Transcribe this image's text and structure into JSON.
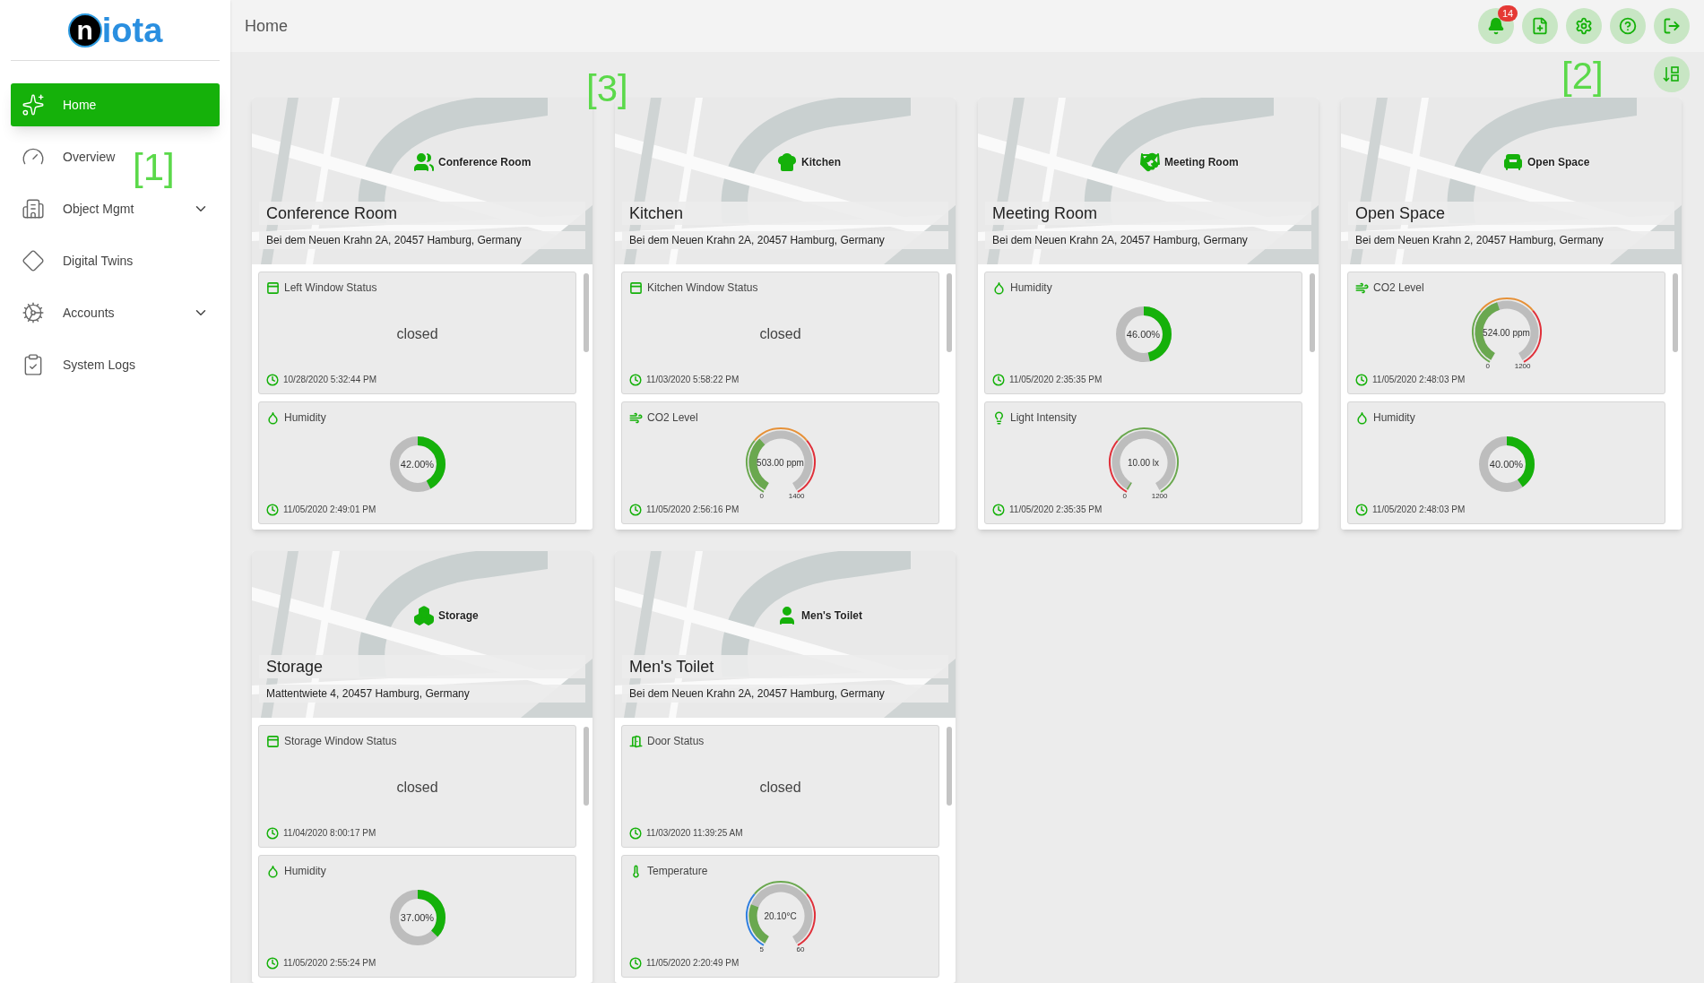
{
  "logo": {
    "mark": "n",
    "text": "iota"
  },
  "sidebar": {
    "items": [
      {
        "label": "Home",
        "kind": "home",
        "selected": true,
        "expandable": false
      },
      {
        "label": "Overview",
        "kind": "overview",
        "selected": false,
        "expandable": false
      },
      {
        "label": "Object Mgmt",
        "kind": "objects",
        "selected": false,
        "expandable": true
      },
      {
        "label": "Digital Twins",
        "kind": "twins",
        "selected": false,
        "expandable": false
      },
      {
        "label": "Accounts",
        "kind": "accounts",
        "selected": false,
        "expandable": true
      },
      {
        "label": "System Logs",
        "kind": "logs",
        "selected": false,
        "expandable": false
      }
    ]
  },
  "header": {
    "title": "Home",
    "notification_count": "14"
  },
  "annotations": [
    "[1]",
    "[2]",
    "[3]"
  ],
  "rooms": [
    {
      "name": "Conference Room",
      "kind": "conference",
      "marker_label": "Conference Room",
      "address": "Bei dem Neuen Krahn 2A, 20457 Hamburg, Germany",
      "widgets": [
        {
          "kind": "window",
          "title": "Left Window Status",
          "value": "closed",
          "timestamp": "10/28/2020 5:32:44 PM"
        },
        {
          "kind": "humidity",
          "title": "Humidity",
          "value": "42.00%",
          "level": 0.42,
          "timestamp": "11/05/2020 2:49:01 PM"
        }
      ]
    },
    {
      "name": "Kitchen",
      "kind": "kitchen",
      "marker_label": "Kitchen",
      "address": "Bei dem Neuen Krahn 2A, 20457 Hamburg, Germany",
      "widgets": [
        {
          "kind": "window",
          "title": "Kitchen Window Status",
          "value": "closed",
          "timestamp": "11/03/2020 5:58:22 PM"
        },
        {
          "kind": "co2",
          "title": "CO2 Level",
          "value": "503.00 ppm",
          "min": "0",
          "max": "1400",
          "level": 0.36,
          "bands": [
            {
              "color": "#6aa84f"
            },
            {
              "color": "#e69138"
            },
            {
              "color": "#e0303a"
            }
          ],
          "timestamp": "11/05/2020 2:56:16 PM"
        }
      ]
    },
    {
      "name": "Meeting Room",
      "kind": "meeting",
      "marker_label": "Meeting Room",
      "address": "Bei dem Neuen Krahn 2A, 20457 Hamburg, Germany",
      "widgets": [
        {
          "kind": "humidity",
          "title": "Humidity",
          "value": "46.00%",
          "level": 0.46,
          "timestamp": "11/05/2020 2:35:35 PM"
        },
        {
          "kind": "light",
          "title": "Light Intensity",
          "value": "10.00 lx",
          "min": "0",
          "max": "1200",
          "level": 0.01,
          "bands": [
            {
              "color": "#e0303a"
            },
            {
              "color": "#6aa84f"
            },
            {
              "color": "#6aa84f"
            }
          ],
          "timestamp": "11/05/2020 2:35:35 PM"
        }
      ]
    },
    {
      "name": "Open Space",
      "kind": "open",
      "marker_label": "Open Space",
      "address": "Bei dem Neuen Krahn 2, 20457 Hamburg, Germany",
      "widgets": [
        {
          "kind": "co2",
          "title": "CO2 Level",
          "value": "524.00 ppm",
          "min": "0",
          "max": "1200",
          "level": 0.44,
          "bands": [
            {
              "color": "#6aa84f"
            },
            {
              "color": "#e69138"
            },
            {
              "color": "#e0303a"
            }
          ],
          "timestamp": "11/05/2020 2:48:03 PM"
        },
        {
          "kind": "humidity",
          "title": "Humidity",
          "value": "40.00%",
          "level": 0.4,
          "timestamp": "11/05/2020 2:48:03 PM"
        }
      ]
    },
    {
      "name": "Storage",
      "kind": "storage",
      "marker_label": "Storage",
      "address": "Mattentwiete 4, 20457 Hamburg, Germany",
      "widgets": [
        {
          "kind": "window",
          "title": "Storage Window Status",
          "value": "closed",
          "timestamp": "11/04/2020 8:00:17 PM"
        },
        {
          "kind": "humidity",
          "title": "Humidity",
          "value": "37.00%",
          "level": 0.37,
          "timestamp": "11/05/2020 2:55:24 PM"
        }
      ]
    },
    {
      "name": "Men's Toilet",
      "kind": "toilet",
      "marker_label": "Men's Toilet",
      "address": "Bei dem Neuen Krahn 2A, 20457 Hamburg, Germany",
      "widgets": [
        {
          "kind": "door",
          "title": "Door Status",
          "value": "closed",
          "timestamp": "11/03/2020 11:39:25 AM"
        },
        {
          "kind": "temperature",
          "title": "Temperature",
          "value": "20.10°C",
          "min": "5",
          "max": "60",
          "level": 0.27,
          "bands": [
            {
              "color": "#2f7fe0"
            },
            {
              "color": "#6aa84f"
            },
            {
              "color": "#e0303a"
            }
          ],
          "timestamp": "11/05/2020 2:20:49 PM"
        }
      ]
    }
  ]
}
